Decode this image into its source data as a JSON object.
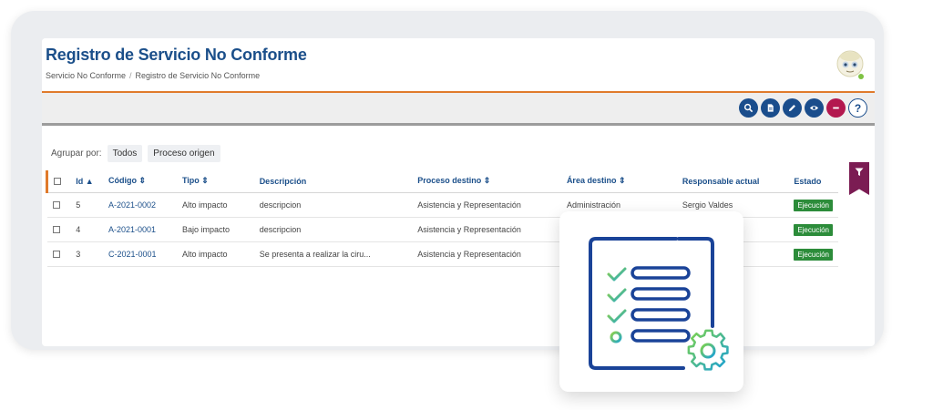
{
  "header": {
    "title": "Registro de Servicio No Conforme",
    "breadcrumb": [
      "Servicio No Conforme",
      "Registro de Servicio No Conforme"
    ]
  },
  "toolbar": {
    "buttons": [
      "search-icon",
      "document-icon",
      "edit-icon",
      "view-icon",
      "remove-icon",
      "help-icon"
    ],
    "help_label": "?"
  },
  "groupby": {
    "label": "Agrupar por:",
    "options": [
      "Todos",
      "Proceso origen"
    ]
  },
  "table": {
    "columns": [
      "Id ▲",
      "Código ⇕",
      "Tipo ⇕",
      "Descripción",
      "Proceso destino ⇕",
      "Área destino ⇕",
      "Responsable actual",
      "Estado"
    ],
    "rows": [
      {
        "id": "5",
        "codigo": "A-2021-0002",
        "tipo": "Alto impacto",
        "descripcion": "descripcion",
        "proceso": "Asistencia y Representación",
        "area": "Administración",
        "responsable": "Sergio Valdes",
        "estado": "Ejecución"
      },
      {
        "id": "4",
        "codigo": "A-2021-0001",
        "tipo": "Bajo impacto",
        "descripcion": "descripcion",
        "proceso": "Asistencia y Representación",
        "area": "",
        "responsable": "",
        "estado": "Ejecución"
      },
      {
        "id": "3",
        "codigo": "C-2021-0001",
        "tipo": "Alto impacto",
        "descripcion": "Se presenta a realizar la ciru...",
        "proceso": "Asistencia y Representación",
        "area": "",
        "responsable": "",
        "estado": "Ejecución"
      }
    ]
  },
  "colors": {
    "brand_blue": "#1b4f8a",
    "accent_orange": "#e07a2b",
    "status_green": "#2c8c3a",
    "filter_magenta": "#7b1c53"
  }
}
